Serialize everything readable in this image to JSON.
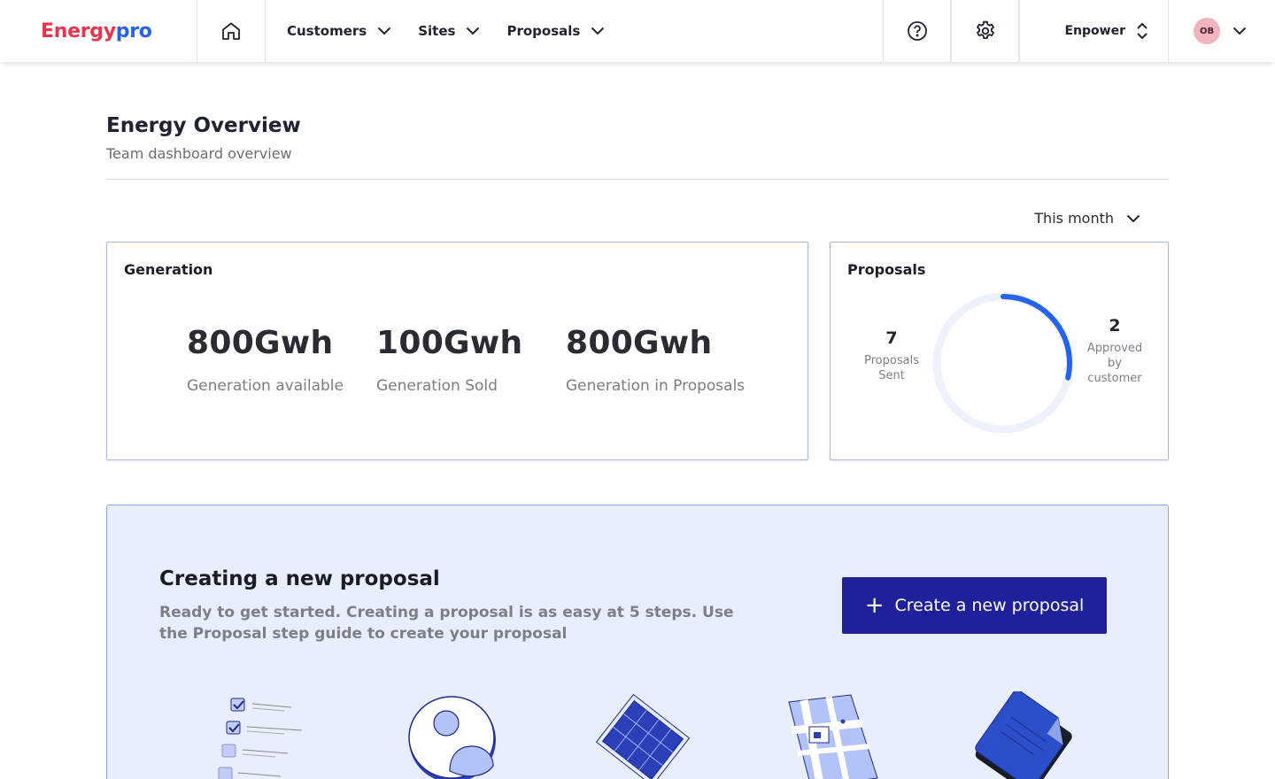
{
  "brand": {
    "logo_part1": "Energy",
    "logo_part2": "pro"
  },
  "nav": {
    "items": [
      {
        "label": "Customers"
      },
      {
        "label": "Sites"
      },
      {
        "label": "Proposals"
      }
    ],
    "org": "Enpower",
    "user_initials": "OB",
    "icons": [
      "home-icon",
      "help-icon",
      "settings-icon",
      "chevron-down-icon",
      "select-arrows-icon"
    ]
  },
  "header": {
    "title": "Energy Overview",
    "subtitle": "Team dashboard overview"
  },
  "period": {
    "selected": "This month"
  },
  "generation": {
    "title": "Generation",
    "stats": [
      {
        "value": "800Gwh",
        "caption": "Generation available"
      },
      {
        "value": "100Gwh",
        "caption": "Generation Sold"
      },
      {
        "value": "800Gwh",
        "caption": "Generation in Proposals"
      }
    ]
  },
  "proposals": {
    "title": "Proposals",
    "sent": {
      "value": "7",
      "label_line1": "Proposals",
      "label_line2": "Sent"
    },
    "approved": {
      "value": "2",
      "label_line1": "Approved",
      "label_line2": "by",
      "label_line3": "customer"
    },
    "ring_fraction": 0.2857
  },
  "banner": {
    "title": "Creating a new proposal",
    "description": "Ready to get started. Creating a proposal is as easy at 5 steps. Use the Proposal step guide to create your proposal",
    "button_label": "Create a new proposal"
  },
  "colors": {
    "accent": "#2563eb",
    "primary_button": "#20219a",
    "logo_red": "#e8354f",
    "banner_bg": "#e9eefd"
  }
}
